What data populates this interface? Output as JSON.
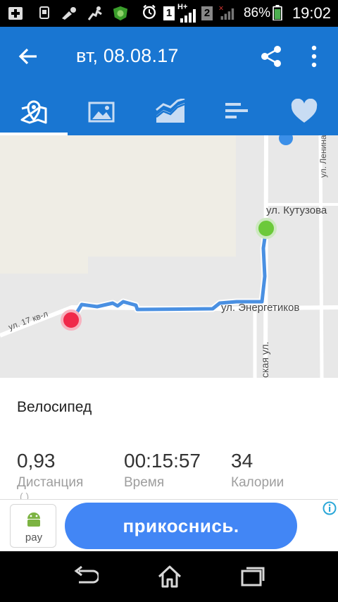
{
  "status_bar": {
    "battery_percent": "86%",
    "time": "19:02",
    "sim1": "1",
    "sim2": "2",
    "network_type": "H+"
  },
  "app_bar": {
    "title": "вт, 08.08.17",
    "active_tab": "map",
    "tabs": [
      {
        "id": "map",
        "icon": "map-icon"
      },
      {
        "id": "photos",
        "icon": "image-icon"
      },
      {
        "id": "charts",
        "icon": "area-chart-icon"
      },
      {
        "id": "stats",
        "icon": "bars-icon"
      },
      {
        "id": "health",
        "icon": "heart-icon"
      }
    ]
  },
  "map": {
    "streets": {
      "kutuzova": "ул. Кутузова",
      "energetikov": "ул. Энергетиков",
      "17kv": "ул. 17 кв-л",
      "lenina": "ул. Ленина",
      "partial": "ская ул."
    },
    "route_color": "#4a90e2",
    "start_color": "#6cc93a",
    "end_color": "#f0284a"
  },
  "workout": {
    "activity": "Велосипед",
    "stats": [
      {
        "value": "0,93",
        "label": "Дистанция"
      },
      {
        "value": "00:15:57",
        "label": "Время"
      },
      {
        "value": "34",
        "label": "Калории"
      }
    ],
    "unit_partial": "( )"
  },
  "ad": {
    "brand": "pay",
    "cta": "прикоснись."
  },
  "colors": {
    "primary": "#1976d2",
    "map_bg": "#e8e8e8"
  }
}
